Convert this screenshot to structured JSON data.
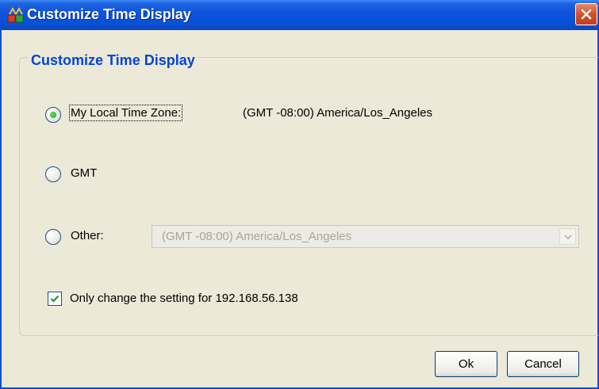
{
  "window": {
    "title": "Customize Time Display"
  },
  "group": {
    "legend": "Customize Time Display"
  },
  "options": {
    "local": {
      "label": "My Local Time Zone:",
      "value": "(GMT -08:00) America/Los_Angeles",
      "selected": true
    },
    "gmt": {
      "label": "GMT",
      "selected": false
    },
    "other": {
      "label": "Other:",
      "selected": false,
      "select_value": "(GMT -08:00) America/Los_Angeles",
      "enabled": false
    }
  },
  "only_change": {
    "label": "Only change the setting for 192.168.56.138",
    "checked": true
  },
  "buttons": {
    "ok": "Ok",
    "cancel": "Cancel"
  },
  "colors": {
    "title_bar": "#0a4fd8",
    "legend": "#0046d5",
    "window_bg": "#ece9d8",
    "close_button": "#d3502c"
  }
}
